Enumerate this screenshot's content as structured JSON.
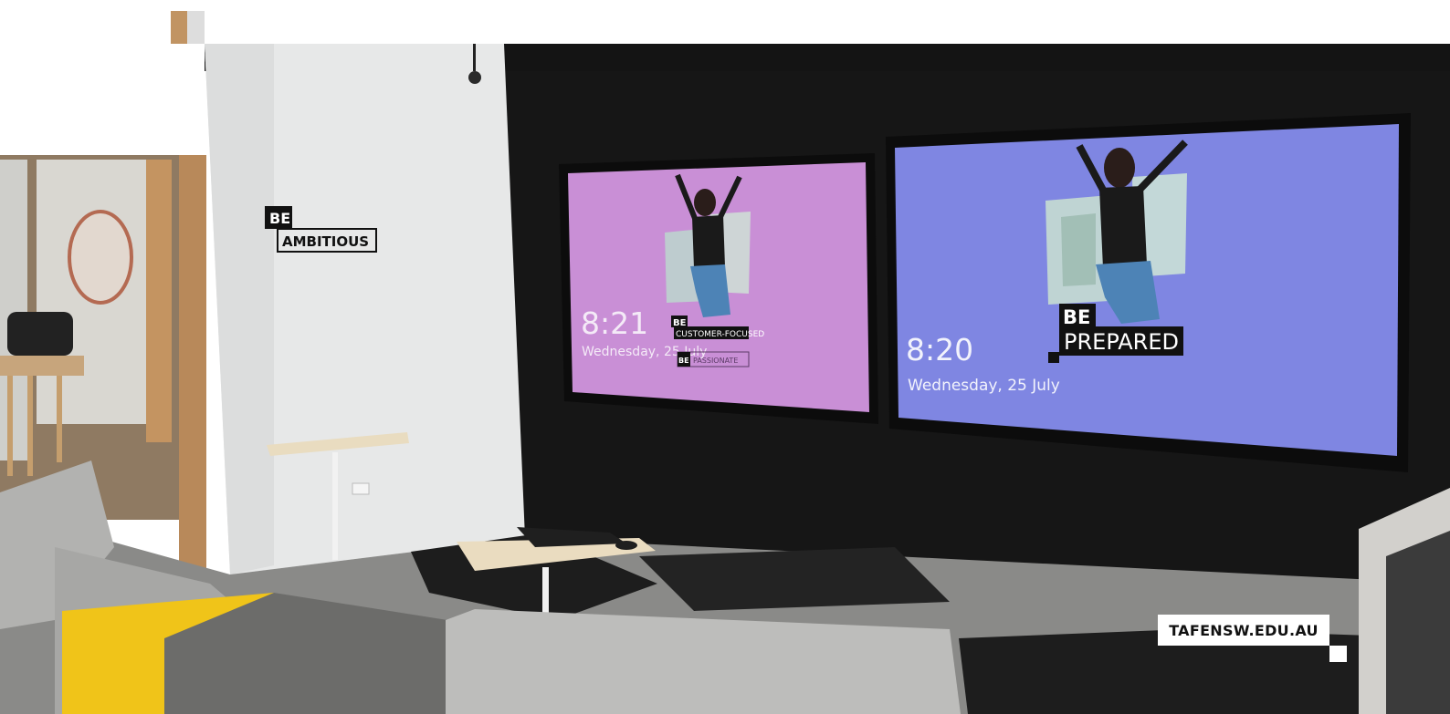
{
  "wall_sign": {
    "line1": "BE",
    "line2": "AMBITIOUS"
  },
  "screen_left": {
    "time": "8:21",
    "date": "Wednesday, 25 July",
    "tag1_be": "BE",
    "tag1_word": "CUSTOMER-FOCUSED",
    "tag2_be": "BE",
    "tag2_word": "PASSIONATE",
    "bg_color": "#c98fd6"
  },
  "screen_right": {
    "time": "8:20",
    "date": "Wednesday, 25 July",
    "tag_be": "BE",
    "tag_word": "PREPARED",
    "bg_color": "#7f86e2"
  },
  "url_badge": "TAFENSW.EDU.AU",
  "colors": {
    "wall_black": "#151515",
    "wall_white": "#e9eaea",
    "floor": "#8a8a88",
    "sofa_grey": "#a9a9a7",
    "sofa_yellow": "#f0c419"
  }
}
